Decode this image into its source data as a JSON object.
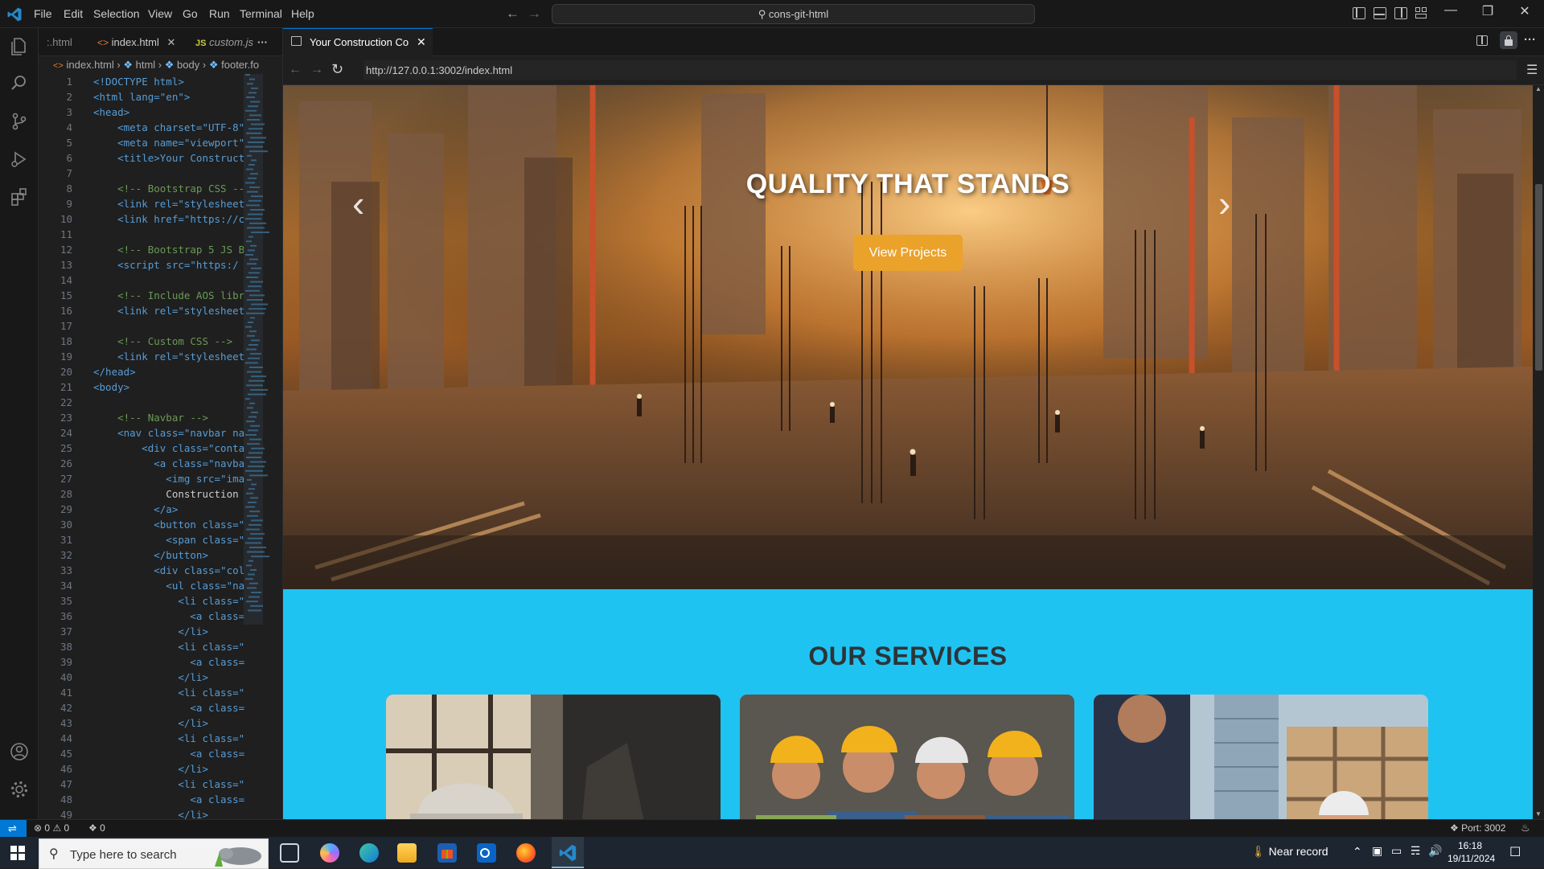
{
  "titlebar": {
    "menu": [
      "File",
      "Edit",
      "Selection",
      "View",
      "Go",
      "Run",
      "Terminal",
      "Help"
    ],
    "command_center": "cons-git-html"
  },
  "editor": {
    "tabs": [
      {
        "label": ":.html"
      },
      {
        "label": "index.html"
      },
      {
        "label": "custom.js",
        "badge": "JS"
      }
    ],
    "breadcrumb": [
      "index.html",
      "html",
      "body",
      "footer.fo"
    ],
    "lines": [
      {
        "n": "1",
        "t": "<!DOCTYPE html>"
      },
      {
        "n": "2",
        "t": "<html lang=\"en\">"
      },
      {
        "n": "3",
        "t": "<head>"
      },
      {
        "n": "4",
        "t": "    <meta charset=\"UTF-8\""
      },
      {
        "n": "5",
        "t": "    <meta name=\"viewport\""
      },
      {
        "n": "6",
        "t": "    <title>Your Construct"
      },
      {
        "n": "7",
        "t": ""
      },
      {
        "n": "8",
        "t": "    <!-- Bootstrap CSS --"
      },
      {
        "n": "9",
        "t": "    <link rel=\"stylesheet"
      },
      {
        "n": "10",
        "t": "    <link href=\"https://c"
      },
      {
        "n": "11",
        "t": ""
      },
      {
        "n": "12",
        "t": "    <!-- Bootstrap 5 JS B"
      },
      {
        "n": "13",
        "t": "    <script src=\"https:/"
      },
      {
        "n": "14",
        "t": ""
      },
      {
        "n": "15",
        "t": "    <!-- Include AOS libr"
      },
      {
        "n": "16",
        "t": "    <link rel=\"stylesheet"
      },
      {
        "n": "17",
        "t": ""
      },
      {
        "n": "18",
        "t": "    <!-- Custom CSS -->"
      },
      {
        "n": "19",
        "t": "    <link rel=\"stylesheet"
      },
      {
        "n": "20",
        "t": "</head>"
      },
      {
        "n": "21",
        "t": "<body>"
      },
      {
        "n": "22",
        "t": ""
      },
      {
        "n": "23",
        "t": "    <!-- Navbar -->"
      },
      {
        "n": "24",
        "t": "    <nav class=\"navbar na"
      },
      {
        "n": "25",
        "t": "        <div class=\"conta"
      },
      {
        "n": "26",
        "t": "          <a class=\"navba"
      },
      {
        "n": "27",
        "t": "            <img src=\"ima"
      },
      {
        "n": "28",
        "t": "            Construction"
      },
      {
        "n": "29",
        "t": "          </a>"
      },
      {
        "n": "30",
        "t": "          <button class=\""
      },
      {
        "n": "31",
        "t": "            <span class=\""
      },
      {
        "n": "32",
        "t": "          </button>"
      },
      {
        "n": "33",
        "t": "          <div class=\"col"
      },
      {
        "n": "34",
        "t": "            <ul class=\"na"
      },
      {
        "n": "35",
        "t": "              <li class=\""
      },
      {
        "n": "36",
        "t": "                <a class="
      },
      {
        "n": "37",
        "t": "              </li>"
      },
      {
        "n": "38",
        "t": "              <li class=\""
      },
      {
        "n": "39",
        "t": "                <a class="
      },
      {
        "n": "40",
        "t": "              </li>"
      },
      {
        "n": "41",
        "t": "              <li class=\""
      },
      {
        "n": "42",
        "t": "                <a class="
      },
      {
        "n": "43",
        "t": "              </li>"
      },
      {
        "n": "44",
        "t": "              <li class=\""
      },
      {
        "n": "45",
        "t": "                <a class="
      },
      {
        "n": "46",
        "t": "              </li>"
      },
      {
        "n": "47",
        "t": "              <li class=\""
      },
      {
        "n": "48",
        "t": "                <a class="
      },
      {
        "n": "49",
        "t": "              </li>"
      }
    ]
  },
  "browser": {
    "tab_label": "Your Construction Co",
    "url": "http://127.0.0.1:3002/index.html",
    "page": {
      "hero_title": "QUALITY THAT STANDS",
      "hero_button": "View Projects",
      "services_title": "OUR SERVICES"
    }
  },
  "statusbar": {
    "errors": "0",
    "warnings": "0",
    "ports": "0",
    "port": "Port: 3002"
  },
  "taskbar": {
    "search_placeholder": "Type here to search",
    "weather": "Near record",
    "time": "16:18",
    "date": "19/11/2024"
  },
  "colors": {
    "accent": "#0078d4",
    "services_bg": "#1fc3f2",
    "hero_button": "#eaa22a"
  }
}
